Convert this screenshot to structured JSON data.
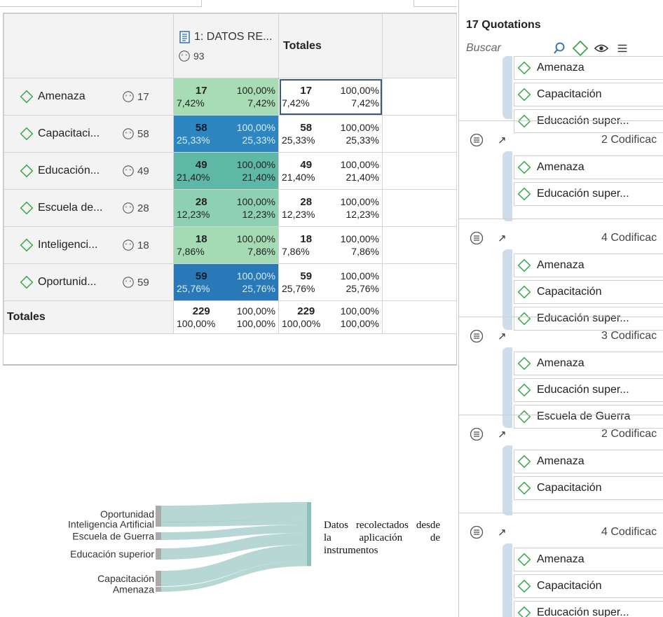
{
  "table": {
    "doc_column": {
      "label": "1: DATOS RE...",
      "count": "93"
    },
    "totals_header": "Totales",
    "rows": [
      {
        "label": "Amenaza",
        "count": "17",
        "doc": [
          "17",
          "100,00%",
          "7,42%",
          "7,42%"
        ],
        "tot": [
          "17",
          "100,00%",
          "7,42%",
          "7,42%"
        ],
        "color": "#a8dcb4"
      },
      {
        "label": "Capacitaci...",
        "count": "58",
        "doc": [
          "58",
          "100,00%",
          "25,33%",
          "25,33%"
        ],
        "tot": [
          "58",
          "100,00%",
          "25,33%",
          "25,33%"
        ],
        "color": "#2e86c1"
      },
      {
        "label": "Educación...",
        "count": "49",
        "doc": [
          "49",
          "100,00%",
          "21,40%",
          "21,40%"
        ],
        "tot": [
          "49",
          "100,00%",
          "21,40%",
          "21,40%"
        ],
        "color": "#5fb8a6"
      },
      {
        "label": "Escuela de...",
        "count": "28",
        "doc": [
          "28",
          "100,00%",
          "12,23%",
          "12,23%"
        ],
        "tot": [
          "28",
          "100,00%",
          "12,23%",
          "12,23%"
        ],
        "color": "#8dd0b2"
      },
      {
        "label": "Inteligenci...",
        "count": "18",
        "doc": [
          "18",
          "100,00%",
          "7,86%",
          "7,86%"
        ],
        "tot": [
          "18",
          "100,00%",
          "7,86%",
          "7,86%"
        ],
        "color": "#a4dab4"
      },
      {
        "label": "Oportunid...",
        "count": "59",
        "doc": [
          "59",
          "100,00%",
          "25,76%",
          "25,76%"
        ],
        "tot": [
          "59",
          "100,00%",
          "25,76%",
          "25,76%"
        ],
        "color": "#2979b8"
      }
    ],
    "totals_row": {
      "label": "Totales",
      "doc": [
        "229",
        "100,00%",
        "100,00%",
        "100,00%"
      ],
      "tot": [
        "229",
        "100,00%",
        "100,00%",
        "100,00%"
      ]
    }
  },
  "sankey": {
    "labels": [
      "Oportunidad",
      "Inteligencia Artificial",
      "Escuela de Guerra",
      "Educación superior",
      "Capacitación",
      "Amenaza"
    ],
    "caption": "Datos recolectados desde la aplicación de instrumentos"
  },
  "quotations": {
    "title": "17 Quotations",
    "search_placeholder": "Buscar",
    "groups": [
      {
        "codificaciones": "",
        "codes": [
          "Amenaza",
          "Capacitación",
          "Educación super..."
        ]
      },
      {
        "codificaciones": "2 Codificac",
        "codes": [
          "Amenaza",
          "Educación super..."
        ]
      },
      {
        "codificaciones": "4 Codificac",
        "codes": [
          "Amenaza",
          "Capacitación",
          "Educación super..."
        ]
      },
      {
        "codificaciones": "3 Codificac",
        "codes": [
          "Amenaza",
          "Educación super...",
          "Escuela de Guerra"
        ]
      },
      {
        "codificaciones": "2 Codificac",
        "codes": [
          "Amenaza",
          "Capacitación"
        ]
      },
      {
        "codificaciones": "4 Codificac",
        "codes": [
          "Amenaza",
          "Capacitación",
          "Educación super..."
        ]
      }
    ]
  },
  "colors": {
    "accent_green": "#3aa84a",
    "stripe": "#cfdcea",
    "selected_border": "#3b5a78"
  }
}
